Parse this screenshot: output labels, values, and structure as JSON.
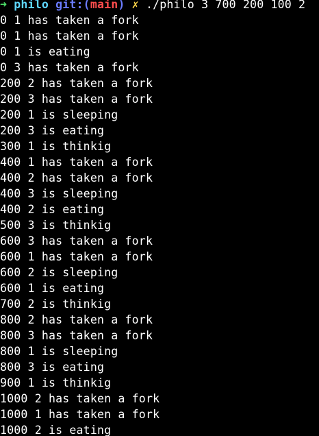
{
  "prompt": {
    "arrow": "➜",
    "directory": "philo",
    "git_prefix": "git:(",
    "branch": "main",
    "git_suffix": ")",
    "dirty_marker": "✗",
    "command": "./philo 3 700 200 100 2"
  },
  "output_lines": [
    "0 1 has taken a fork",
    "0 1 has taken a fork",
    "0 1 is eating",
    "0 3 has taken a fork",
    "200 2 has taken a fork",
    "200 3 has taken a fork",
    "200 1 is sleeping",
    "200 3 is eating",
    "300 1 is thinkig",
    "400 1 has taken a fork",
    "400 2 has taken a fork",
    "400 3 is sleeping",
    "400 2 is eating",
    "500 3 is thinkig",
    "600 3 has taken a fork",
    "600 1 has taken a fork",
    "600 2 is sleeping",
    "600 1 is eating",
    "700 2 is thinkig",
    "800 2 has taken a fork",
    "800 3 has taken a fork",
    "800 1 is sleeping",
    "800 3 is eating",
    "900 1 is thinkig",
    "1000 2 has taken a fork",
    "1000 1 has taken a fork",
    "1000 2 is eating"
  ]
}
